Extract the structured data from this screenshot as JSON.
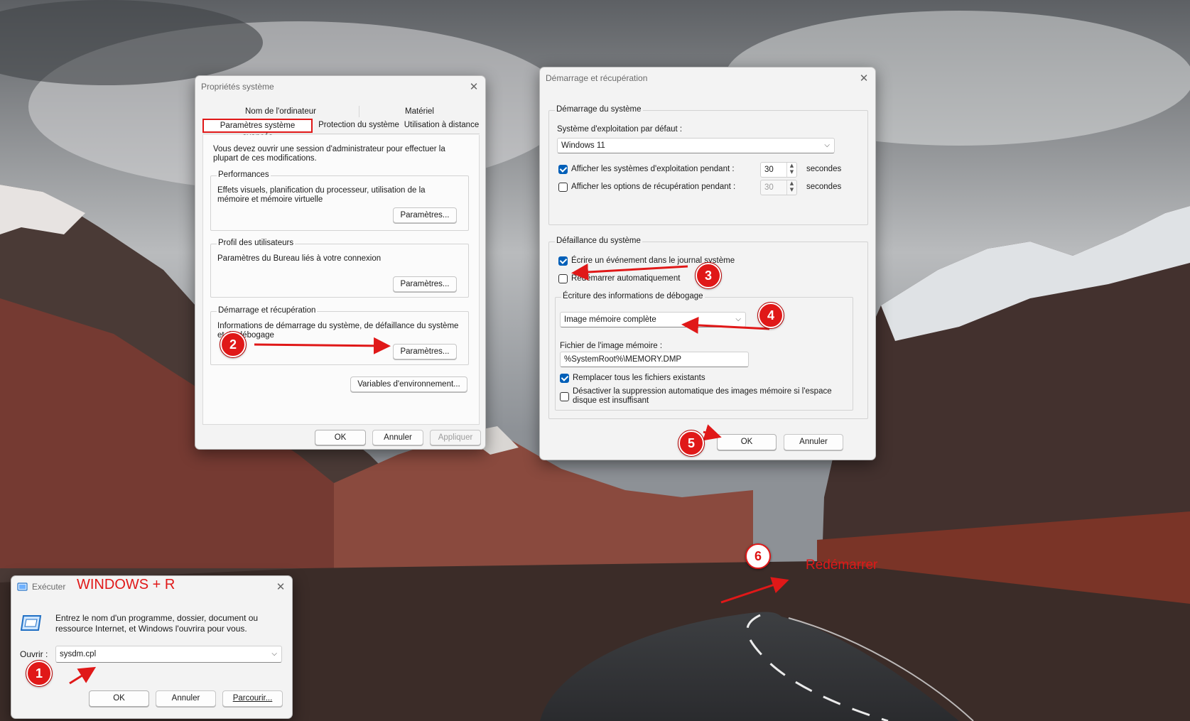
{
  "colors": {
    "accent": "#005fb8",
    "annotation_red": "#e01818",
    "window_bg": "#f3f3f3"
  },
  "system_properties": {
    "title": "Propriétés système",
    "tabs_top": [
      "Nom de l'ordinateur",
      "Matériel"
    ],
    "tabs_bottom": [
      "Paramètres système avancés",
      "Protection du système",
      "Utilisation à distance"
    ],
    "admin_note": "Vous devez ouvrir une session d'administrateur pour effectuer la plupart de ces modifications.",
    "performance": {
      "title": "Performances",
      "desc": "Effets visuels, planification du processeur, utilisation de la mémoire et mémoire virtuelle",
      "button": "Paramètres..."
    },
    "user_profiles": {
      "title": "Profil des utilisateurs",
      "desc": "Paramètres du Bureau liés à votre connexion",
      "button": "Paramètres..."
    },
    "startup_recovery": {
      "title": "Démarrage et récupération",
      "desc": "Informations de démarrage du système, de défaillance du système et de débogage",
      "button": "Paramètres..."
    },
    "env_button": "Variables d'environnement...",
    "ok": "OK",
    "cancel": "Annuler",
    "apply": "Appliquer"
  },
  "startup_dialog": {
    "title": "Démarrage et récupération",
    "system_startup": {
      "title": "Démarrage du système",
      "default_os_label": "Système d'exploitation par défaut :",
      "default_os_value": "Windows 11",
      "show_os_label": "Afficher les systèmes d'exploitation pendant :",
      "show_os_checked": true,
      "show_os_value": "30",
      "show_recovery_label": "Afficher les options de récupération pendant :",
      "show_recovery_checked": false,
      "show_recovery_value": "30",
      "seconds": "secondes"
    },
    "system_failure": {
      "title": "Défaillance du système",
      "write_event_label": "Écrire un événement dans le journal système",
      "write_event_checked": true,
      "auto_restart_label": "Redémarrer automatiquement",
      "auto_restart_checked": false,
      "debug_title": "Écriture des informations de débogage",
      "debug_value": "Image mémoire complète",
      "dump_file_label": "Fichier de l'image mémoire :",
      "dump_file_value": "%SystemRoot%\\MEMORY.DMP",
      "overwrite_label": "Remplacer tous les fichiers existants",
      "overwrite_checked": true,
      "disable_auto_delete_label": "Désactiver la suppression automatique des images mémoire si l'espace disque est insuffisant",
      "disable_auto_delete_checked": false
    },
    "ok": "OK",
    "cancel": "Annuler"
  },
  "run_dialog": {
    "title": "Exécuter",
    "description": "Entrez le nom d'un programme, dossier, document ou ressource Internet, et Windows l'ouvrira pour vous.",
    "open_label": "Ouvrir :",
    "open_value": "sysdm.cpl",
    "ok": "OK",
    "cancel": "Annuler",
    "browse": "Parcourir..."
  },
  "annotations": {
    "shortcut": "WINDOWS + R",
    "restart": "Redémarrer",
    "steps": [
      "1",
      "2",
      "3",
      "4",
      "5",
      "6"
    ]
  }
}
